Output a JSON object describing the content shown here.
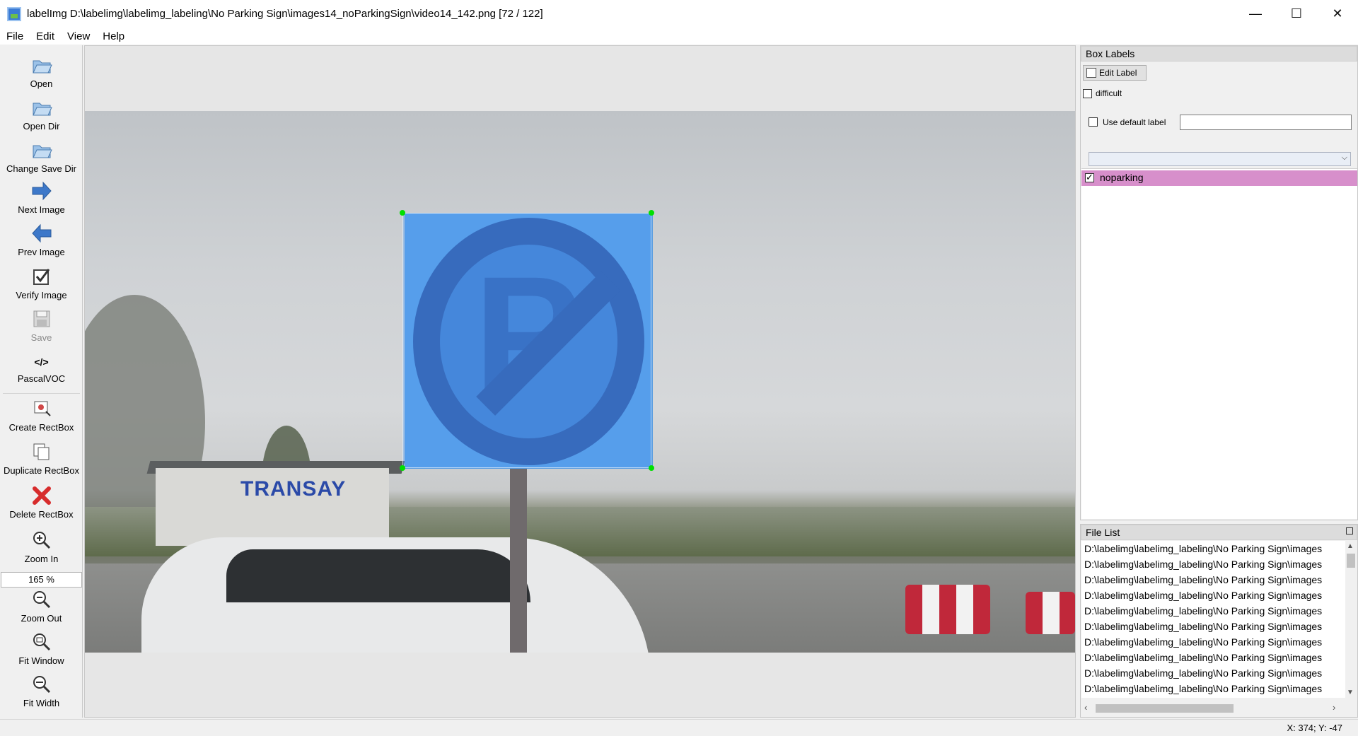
{
  "window": {
    "title": "labelImg D:\\labelimg\\labelimg_labeling\\No Parking Sign\\images14_noParkingSign\\video14_142.png [72 / 122]",
    "controls": [
      "—",
      "☐",
      "✕"
    ]
  },
  "menu": [
    "File",
    "Edit",
    "View",
    "Help"
  ],
  "toolbar": {
    "open": "Open",
    "open_dir": "Open Dir",
    "change_save_dir": "Change Save Dir",
    "next_image": "Next Image",
    "prev_image": "Prev Image",
    "verify_image": "Verify Image",
    "save": "Save",
    "format": "PascalVOC",
    "format_icon": "</>",
    "create_rectbox": "Create RectBox",
    "duplicate_rectbox": "Duplicate RectBox",
    "delete_rectbox": "Delete RectBox",
    "zoom_in": "Zoom In",
    "zoom_value": "165 %",
    "zoom_out": "Zoom Out",
    "fit_window": "Fit Window",
    "fit_width": "Fit Width"
  },
  "canvas": {
    "photo_sign_text": "TRANSAY"
  },
  "box_labels": {
    "title": "Box Labels",
    "edit_label": "Edit Label",
    "difficult": "difficult",
    "difficult_checked": false,
    "use_default_label": "Use default label",
    "use_default_checked": false,
    "default_label_value": "",
    "labels": [
      {
        "text": "noparking",
        "checked": true,
        "color": "#d78fcb"
      }
    ]
  },
  "file_list": {
    "title": "File List",
    "files": [
      "D:\\labelimg\\labelimg_labeling\\No Parking Sign\\images",
      "D:\\labelimg\\labelimg_labeling\\No Parking Sign\\images",
      "D:\\labelimg\\labelimg_labeling\\No Parking Sign\\images",
      "D:\\labelimg\\labelimg_labeling\\No Parking Sign\\images",
      "D:\\labelimg\\labelimg_labeling\\No Parking Sign\\images",
      "D:\\labelimg\\labelimg_labeling\\No Parking Sign\\images",
      "D:\\labelimg\\labelimg_labeling\\No Parking Sign\\images",
      "D:\\labelimg\\labelimg_labeling\\No Parking Sign\\images",
      "D:\\labelimg\\labelimg_labeling\\No Parking Sign\\images",
      "D:\\labelimg\\labelimg_labeling\\No Parking Sign\\images"
    ]
  },
  "status": {
    "coords": "X: 374; Y: -47"
  },
  "colors": {
    "bbox_fill": "#50a0ff",
    "handle": "#00e000",
    "selected_label": "#d78fcb"
  }
}
